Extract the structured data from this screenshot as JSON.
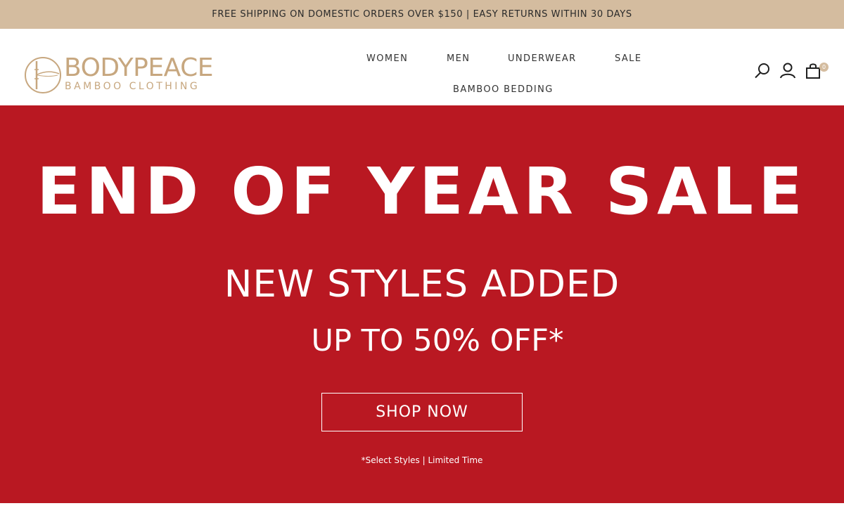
{
  "announcement": {
    "text": "FREE SHIPPING ON DOMESTIC ORDERS OVER $150 | EASY RETURNS WITHIN 30 DAYS"
  },
  "logo": {
    "name": "BODYPEACE",
    "tagline": "BAMBOO CLOTHING"
  },
  "nav": {
    "women": "WOMEN",
    "men": "MEN",
    "underwear": "UNDERWEAR",
    "sale": "SALE",
    "bedding": "BAMBOO BEDDING"
  },
  "header_icons": {
    "search": "search-icon",
    "account": "user-icon",
    "cart": "shopping-bag-icon",
    "cart_count": "0"
  },
  "hero": {
    "title": "END OF YEAR SALE",
    "subtitle": "NEW STYLES ADDED",
    "offer": "UP TO 50% OFF*",
    "cta": "SHOP NOW",
    "note": "*Select Styles | Limited Time"
  },
  "colors": {
    "announcement_bg": "#d4bc9f",
    "brand_gold": "#c7a77f",
    "hero_red": "#b91822",
    "text_white": "#ffffff"
  }
}
